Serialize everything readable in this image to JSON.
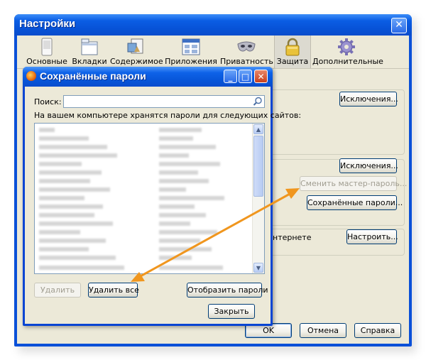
{
  "main_window": {
    "title": "Настройки",
    "close_glyph": "✕",
    "toolbar": [
      {
        "label": "Основные",
        "icon": "general-icon",
        "selected": false
      },
      {
        "label": "Вкладки",
        "icon": "tabs-icon",
        "selected": false
      },
      {
        "label": "Содержимое",
        "icon": "content-icon",
        "selected": false
      },
      {
        "label": "Приложения",
        "icon": "applications-icon",
        "selected": false
      },
      {
        "label": "Приватность",
        "icon": "privacy-icon",
        "selected": false
      },
      {
        "label": "Защита",
        "icon": "lock-icon",
        "selected": true
      },
      {
        "label": "Дополнительные",
        "icon": "gear-icon",
        "selected": false
      }
    ],
    "exceptions_button_1": "Исключения...",
    "exceptions_button_2": "Исключения...",
    "change_master_password": "Сменить мастер-пароль...",
    "saved_passwords_button": "Сохранённые пароли...",
    "internet_text": "нтернете",
    "configure_button": "Настроить...",
    "ok_button": "OK",
    "cancel_button": "Отмена",
    "help_button": "Справка"
  },
  "dialog": {
    "title": "Сохранённые пароли",
    "search_label": "Поиск:",
    "search_value": "",
    "description": "На вашем компьютере хранятся пароли для следующих сайтов:",
    "delete_button": "Удалить",
    "delete_all_button": "Удалить все",
    "show_passwords_button": "Отобразить пароли",
    "close_button": "Закрыть",
    "minimize_glyph": "_",
    "maximize_glyph": "□",
    "close_glyph": "✕"
  },
  "colors": {
    "xp_title_blue": "#0752d6",
    "dialog_face": "#ece9d8",
    "annotation_arrow": "#f0961e"
  }
}
